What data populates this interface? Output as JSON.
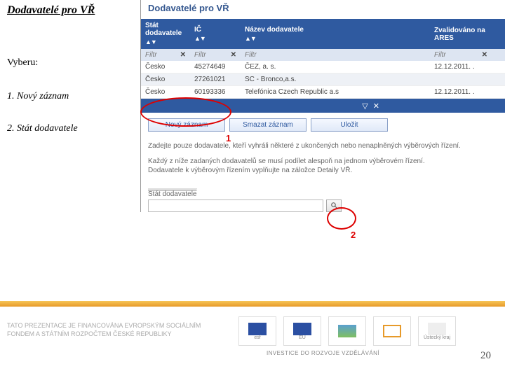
{
  "slide": {
    "title_underlined": "Dodavatelé pro VŘ",
    "vyberu": "Vyberu:",
    "step1": "1. Nový záznam",
    "step2": "2. Stát dodavatele"
  },
  "panel": {
    "title": "Dodavatelé pro VŘ",
    "columns": {
      "stat": "Stát dodavatele",
      "ic": "IČ",
      "nazev": "Název dodavatele",
      "zval": "Zvalidováno na ARES"
    },
    "filter_label": "Filtr",
    "filter_x": "✕",
    "rows": [
      {
        "stat": "Česko",
        "ic": "45274649",
        "nazev": "ČEZ, a. s.",
        "zvalid": "12.12.2011. ."
      },
      {
        "stat": "Česko",
        "ic": "27261021",
        "nazev": "SC - Bronco,a.s.",
        "zvalid": ""
      },
      {
        "stat": "Česko",
        "ic": "60193336",
        "nazev": "Telefónica Czech Republic a.s",
        "zvalid": "12.12.2011. ."
      }
    ],
    "footer_icons": "▽ ✕"
  },
  "buttons": {
    "novy": "Nový záznam",
    "smazat": "Smazat záznam",
    "ulozit": "Uložit"
  },
  "annotations": {
    "a1": "1",
    "a2": "2"
  },
  "info": {
    "l1": "Zadejte pouze dodavatele, kteří vyhráli některé z ukončených nebo nenaplněných výběrových řízení.",
    "l2": "Každý z níže zadaných dodavatelů se musí podílet alespoň na jednom výběrovém řízení.",
    "l3": "Dodavatele k výběrovým řízením vyplňujte na záložce Detaily VŘ."
  },
  "field": {
    "label": "Stát dodavatele"
  },
  "footer": {
    "left1": "TATO PREZENTACE JE FINANCOVÁNA EVROPSKÝM SOCIÁLNÍM",
    "left2": "FONDEM A STÁTNÍM ROZPOČTEM ČESKÉ REPUBLIKY",
    "caption": "INVESTICE DO ROZVOJE VZDĚLÁVÁNÍ",
    "page": "20"
  }
}
